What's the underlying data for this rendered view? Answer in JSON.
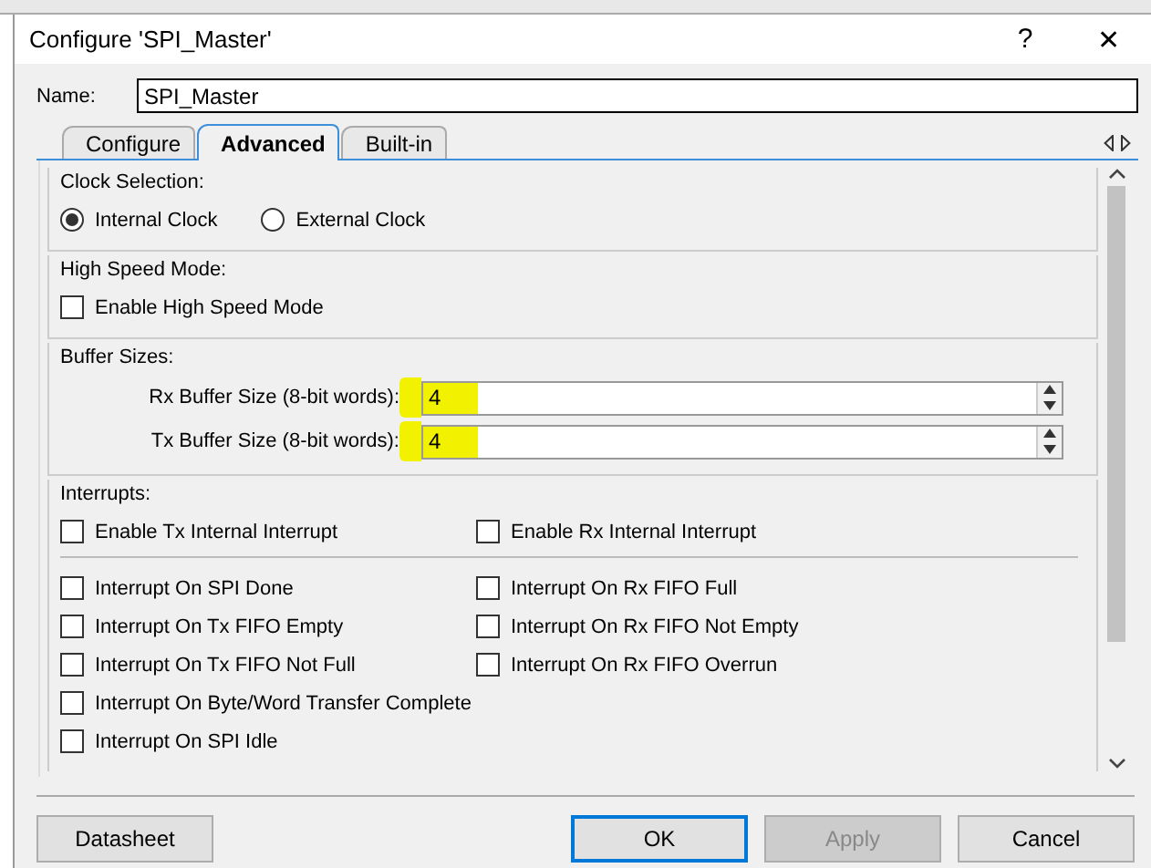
{
  "window": {
    "title": "Configure 'SPI_Master'",
    "help": "?",
    "close": "✕"
  },
  "name_field": {
    "label": "Name:",
    "value": "SPI_Master"
  },
  "tabs": [
    {
      "label": "Configure",
      "selected": false
    },
    {
      "label": "Advanced",
      "selected": true
    },
    {
      "label": "Built-in",
      "selected": false
    }
  ],
  "clock_selection": {
    "title": "Clock Selection:",
    "options": [
      {
        "label": "Internal Clock",
        "selected": true
      },
      {
        "label": "External Clock",
        "selected": false
      }
    ]
  },
  "high_speed_mode": {
    "title": "High Speed Mode:",
    "options": [
      {
        "label": "Enable High Speed Mode",
        "checked": false
      }
    ]
  },
  "buffer_sizes": {
    "title": "Buffer Sizes:",
    "fields": [
      {
        "label": "Rx Buffer Size (8-bit words):",
        "value": "4",
        "highlighted": true
      },
      {
        "label": "Tx Buffer Size (8-bit words):",
        "value": "4",
        "highlighted": true
      }
    ]
  },
  "interrupts": {
    "title": "Interrupts:",
    "top": [
      {
        "label": "Enable Tx Internal Interrupt",
        "checked": false
      },
      {
        "label": "Enable Rx Internal Interrupt",
        "checked": false
      }
    ],
    "left": [
      {
        "label": "Interrupt On SPI Done",
        "checked": false
      },
      {
        "label": "Interrupt On Tx FIFO Empty",
        "checked": false
      },
      {
        "label": "Interrupt On Tx FIFO Not Full",
        "checked": false
      },
      {
        "label": "Interrupt On Byte/Word Transfer Complete",
        "checked": false
      },
      {
        "label": "Interrupt On SPI Idle",
        "checked": false
      }
    ],
    "right": [
      {
        "label": "Interrupt On Rx FIFO Full",
        "checked": false
      },
      {
        "label": "Interrupt On Rx FIFO Not Empty",
        "checked": false
      },
      {
        "label": "Interrupt On Rx FIFO Overrun",
        "checked": false
      }
    ]
  },
  "buttons": [
    {
      "label": "Datasheet",
      "kind": "left",
      "disabled": false,
      "default": false
    },
    {
      "label": "OK",
      "kind": "right",
      "disabled": false,
      "default": true
    },
    {
      "label": "Apply",
      "kind": "right",
      "disabled": true,
      "default": false
    },
    {
      "label": "Cancel",
      "kind": "right",
      "disabled": false,
      "default": false
    }
  ]
}
